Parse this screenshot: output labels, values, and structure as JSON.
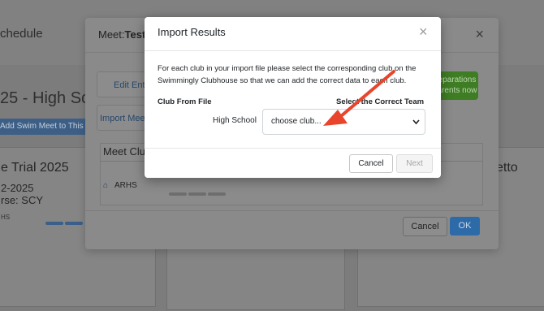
{
  "background": {
    "page_title": "chedule",
    "heading": "25 - High Sc",
    "add_meet_button": "Add Swim Meet to This S",
    "card_left": {
      "title": "e Trial 2025",
      "date": "2-2025",
      "course": "rse: SCY",
      "club": "HS"
    },
    "card_right": {
      "title": "etto"
    }
  },
  "meet_modal": {
    "title_prefix": "Meet:",
    "title_name": "Test I",
    "close": "×",
    "edit_entries_button": "Edit Entri",
    "import_meet_button": "Import Meet",
    "green_button_line1": "eparations",
    "green_button_line2": "arents now",
    "table_header": "Meet Clu",
    "club_name": "ARHS",
    "home_icon": "home-icon",
    "cancel_button": "Cancel",
    "ok_button": "OK"
  },
  "import_dialog": {
    "title": "Import Results",
    "close": "×",
    "instructions": "For each club in your import file please select the corresponding club on the Swimmingly Clubhouse so that we can add the correct data to each club.",
    "col_club_from_file": "Club From File",
    "col_select_team": "Select the Correct Team",
    "rows": [
      {
        "club": "High School",
        "select_value": "choose club..."
      }
    ],
    "cancel_button": "Cancel",
    "next_button": "Next",
    "arrow_color": "#e8452c"
  }
}
